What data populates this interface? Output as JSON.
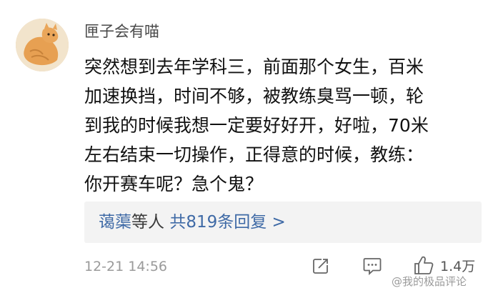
{
  "comment": {
    "author": "匣子会有喵",
    "lines": [
      "突然想到去年学科三，前面那个女生，百米",
      "加速换挡，时间不够，被教练臭骂一顿，轮",
      "到我的时候我想一定要好好开，好啦，70米",
      "左右结束一切操作，正得意的时候，教练：",
      "你开赛车呢？急个鬼？"
    ],
    "replies": {
      "names": "蔼蕖",
      "others": "等人",
      "count_text": "共819条回复 >"
    },
    "timestamp": "12-21 14:56",
    "like_count": "1.4万",
    "watermark": "@我的极品评论"
  },
  "icons": {
    "avatar": "cat-avatar",
    "share": "share-icon",
    "reply": "comment-icon",
    "like": "thumbs-up-icon"
  },
  "colors": {
    "link_blue": "#3f6aa6",
    "reply_bg": "#f3f3f3"
  }
}
